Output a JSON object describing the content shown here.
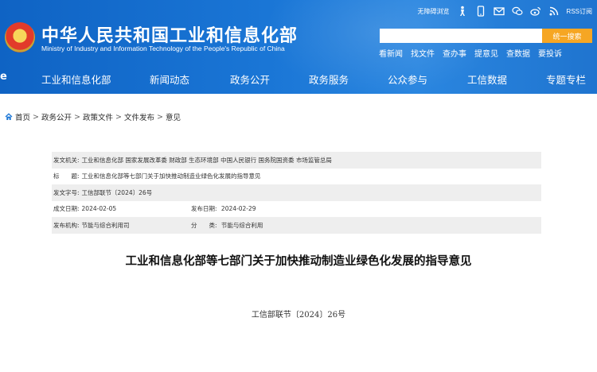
{
  "header": {
    "ministry_cn": "中华人民共和国工业和信息化部",
    "ministry_en": "Ministry of Industry and Information Technology of the People's Republic of China",
    "top_links": {
      "accessibility": "无障碍浏览",
      "rss": "RSS订阅"
    },
    "search": {
      "placeholder": "",
      "button_label": "统一搜索"
    },
    "quick_links": [
      "看新闻",
      "找文件",
      "查办事",
      "提意见",
      "查数据",
      "要投诉"
    ],
    "nav": [
      "工业和信息化部",
      "新闻动态",
      "政务公开",
      "政务服务",
      "公众参与",
      "工信数据",
      "专题专栏"
    ],
    "colors": {
      "header_blue": "#1a76d6",
      "search_orange": "#f6a623"
    }
  },
  "breadcrumb": [
    "首页",
    "政务公开",
    "政策文件",
    "文件发布",
    "意见"
  ],
  "meta": {
    "issuer_label": "发文机关:",
    "issuer_value": "工业和信息化部 国家发展改革委 财政部 生态环境部 中国人民银行 国务院国资委 市场监管总局",
    "title_label": "标　　题:",
    "title_value": "工业和信息化部等七部门关于加快推动制造业绿色化发展的指导意见",
    "docno_label": "发文字号:",
    "docno_value": "工信部联节〔2024〕26号",
    "written_label": "成文日期:",
    "written_value": "2024-02-05",
    "published_label": "发布日期:",
    "published_value": "2024-02-29",
    "org_label": "发布机构:",
    "org_value": "节能与综合利用司",
    "category_label": "分　　类:",
    "category_value": "节能与综合利用"
  },
  "document": {
    "title": "工业和信息化部等七部门关于加快推动制造业绿色化发展的指导意见",
    "number": "工信部联节〔2024〕26号"
  }
}
